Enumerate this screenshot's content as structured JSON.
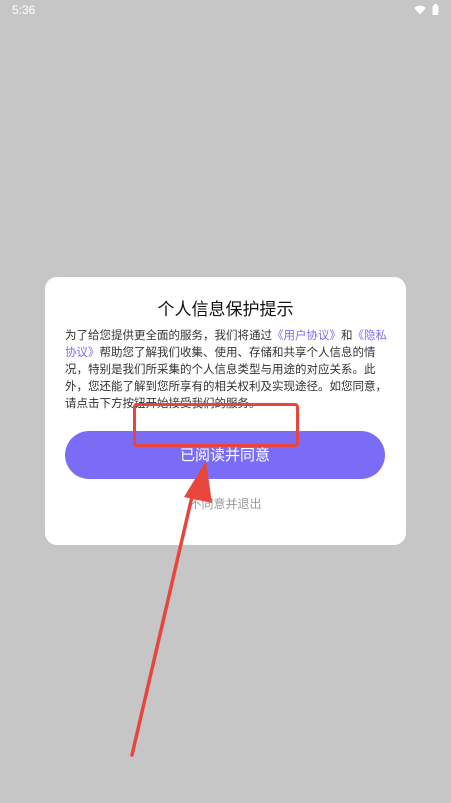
{
  "status_bar": {
    "time": "5:36",
    "icons": [
      "wifi-icon",
      "battery-icon"
    ]
  },
  "dialog": {
    "title": "个人信息保护提示",
    "body": {
      "intro": "为了给您提供更全面的服务，我们将通过",
      "user_agreement": "《用户协议》",
      "and": "和",
      "privacy_policy": "《隐私协议》",
      "rest": "帮助您了解我们收集、使用、存储和共享个人信息的情况，特别是我们所采集的个人信息类型与用途的对应关系。此外，您还能了解到您所享有的相关权利及实现途径。如您同意，请点击下方按钮开始接受我们的服务。"
    },
    "agree_label": "已阅读并同意",
    "decline_label": "不同意并退出"
  },
  "colors": {
    "accent": "#7b6cf6",
    "annotation": "#e8453c",
    "backdrop": "#c6c6c6"
  }
}
